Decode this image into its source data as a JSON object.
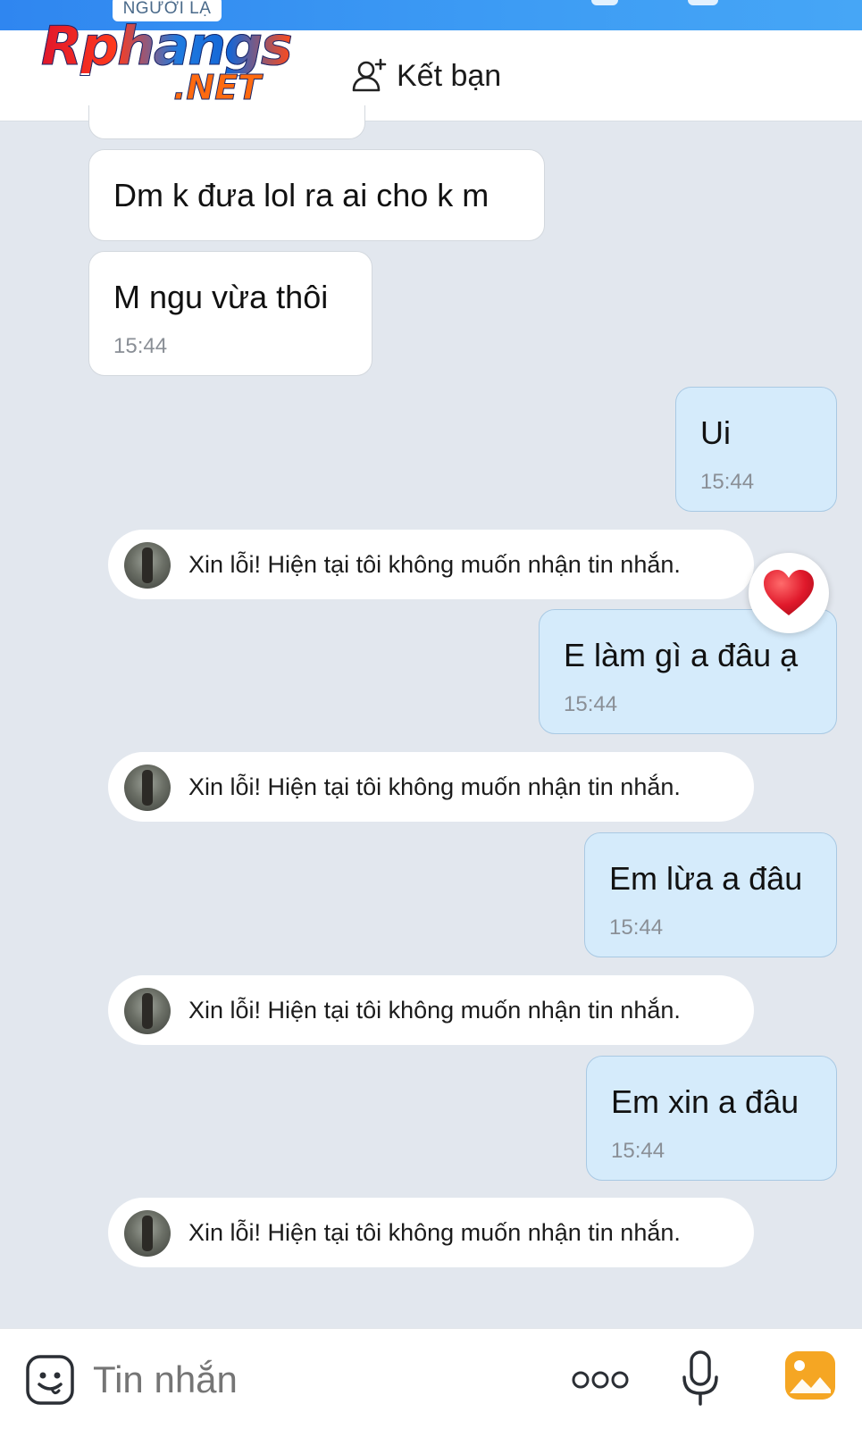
{
  "top": {
    "badge": "NGƯỜI LẠ"
  },
  "header": {
    "logo_main": "Rphangs",
    "logo_net": ".NET",
    "add_friend_label": "Kết bạn",
    "add_friend_icon": "person-plus-icon"
  },
  "messages": {
    "m1": {
      "text": "Dm k đưa lol ra ai cho k m"
    },
    "m2": {
      "text": "M ngu vừa thôi",
      "time": "15:44"
    },
    "m3": {
      "text": "Ui",
      "time": "15:44"
    },
    "sys1": {
      "text": "Xin lỗi! Hiện tại tôi không muốn nhận tin nhắn."
    },
    "m4": {
      "text": "E làm gì a đâu ạ",
      "time": "15:44",
      "reaction": "heart"
    },
    "sys2": {
      "text": "Xin lỗi! Hiện tại tôi không muốn nhận tin nhắn."
    },
    "m5": {
      "text": "Em lừa a đâu",
      "time": "15:44"
    },
    "sys3": {
      "text": "Xin lỗi! Hiện tại tôi không muốn nhận tin nhắn."
    },
    "m6": {
      "text": "Em xin a đâu",
      "time": "15:44"
    },
    "sys4": {
      "text": "Xin lỗi! Hiện tại tôi không muốn nhận tin nhắn."
    }
  },
  "composer": {
    "placeholder": "Tin nhắn",
    "icons": [
      "emoji-icon",
      "more-icon",
      "microphone-icon",
      "image-icon"
    ]
  },
  "colors": {
    "top_bar": "#3d9cf4",
    "outgoing_bubble": "#d5ebfb",
    "incoming_bubble": "#ffffff",
    "chat_background": "#e2e7ee",
    "image_button": "#f5a623",
    "reaction_heart": "#e0192b"
  }
}
